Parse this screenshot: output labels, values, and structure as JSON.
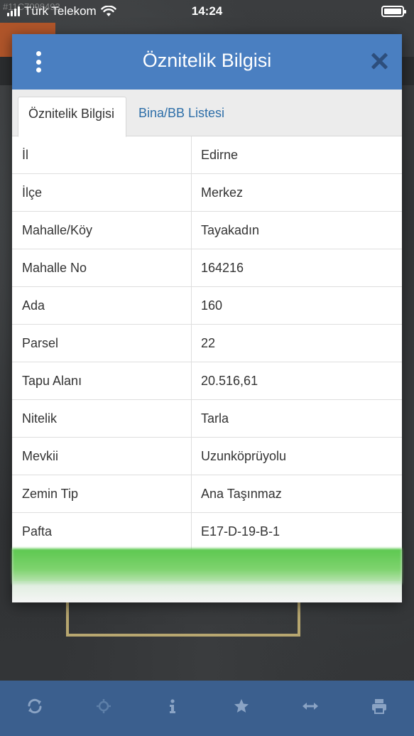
{
  "status_bar": {
    "carrier": "Türk Telekom",
    "time": "14:24",
    "watermark": "#11C7098493"
  },
  "dialog": {
    "title": "Öznitelik Bilgisi",
    "tabs": [
      {
        "label": "Öznitelik Bilgisi",
        "active": true
      },
      {
        "label": "Bina/BB Listesi",
        "active": false
      }
    ],
    "rows": [
      {
        "key": "İl",
        "value": "Edirne"
      },
      {
        "key": "İlçe",
        "value": "Merkez"
      },
      {
        "key": "Mahalle/Köy",
        "value": "Tayakadın"
      },
      {
        "key": "Mahalle No",
        "value": "164216"
      },
      {
        "key": "Ada",
        "value": "160"
      },
      {
        "key": "Parsel",
        "value": "22"
      },
      {
        "key": "Tapu Alanı",
        "value": "20.516,61"
      },
      {
        "key": "Nitelik",
        "value": "Tarla"
      },
      {
        "key": "Mevkii",
        "value": "Uzunköprüyolu"
      },
      {
        "key": "Zemin Tip",
        "value": "Ana Taşınmaz"
      },
      {
        "key": "Pafta",
        "value": "E17-D-19-B-1"
      }
    ]
  },
  "toolbar": {
    "icons": [
      "refresh-icon",
      "locate-icon",
      "info-icon",
      "star-icon",
      "measure-icon",
      "print-icon"
    ]
  },
  "colors": {
    "header": "#4a7fc1",
    "toolbar": "#3b5f8e",
    "tab_link": "#2d6ea8",
    "green_bar": "#5cc84f"
  }
}
